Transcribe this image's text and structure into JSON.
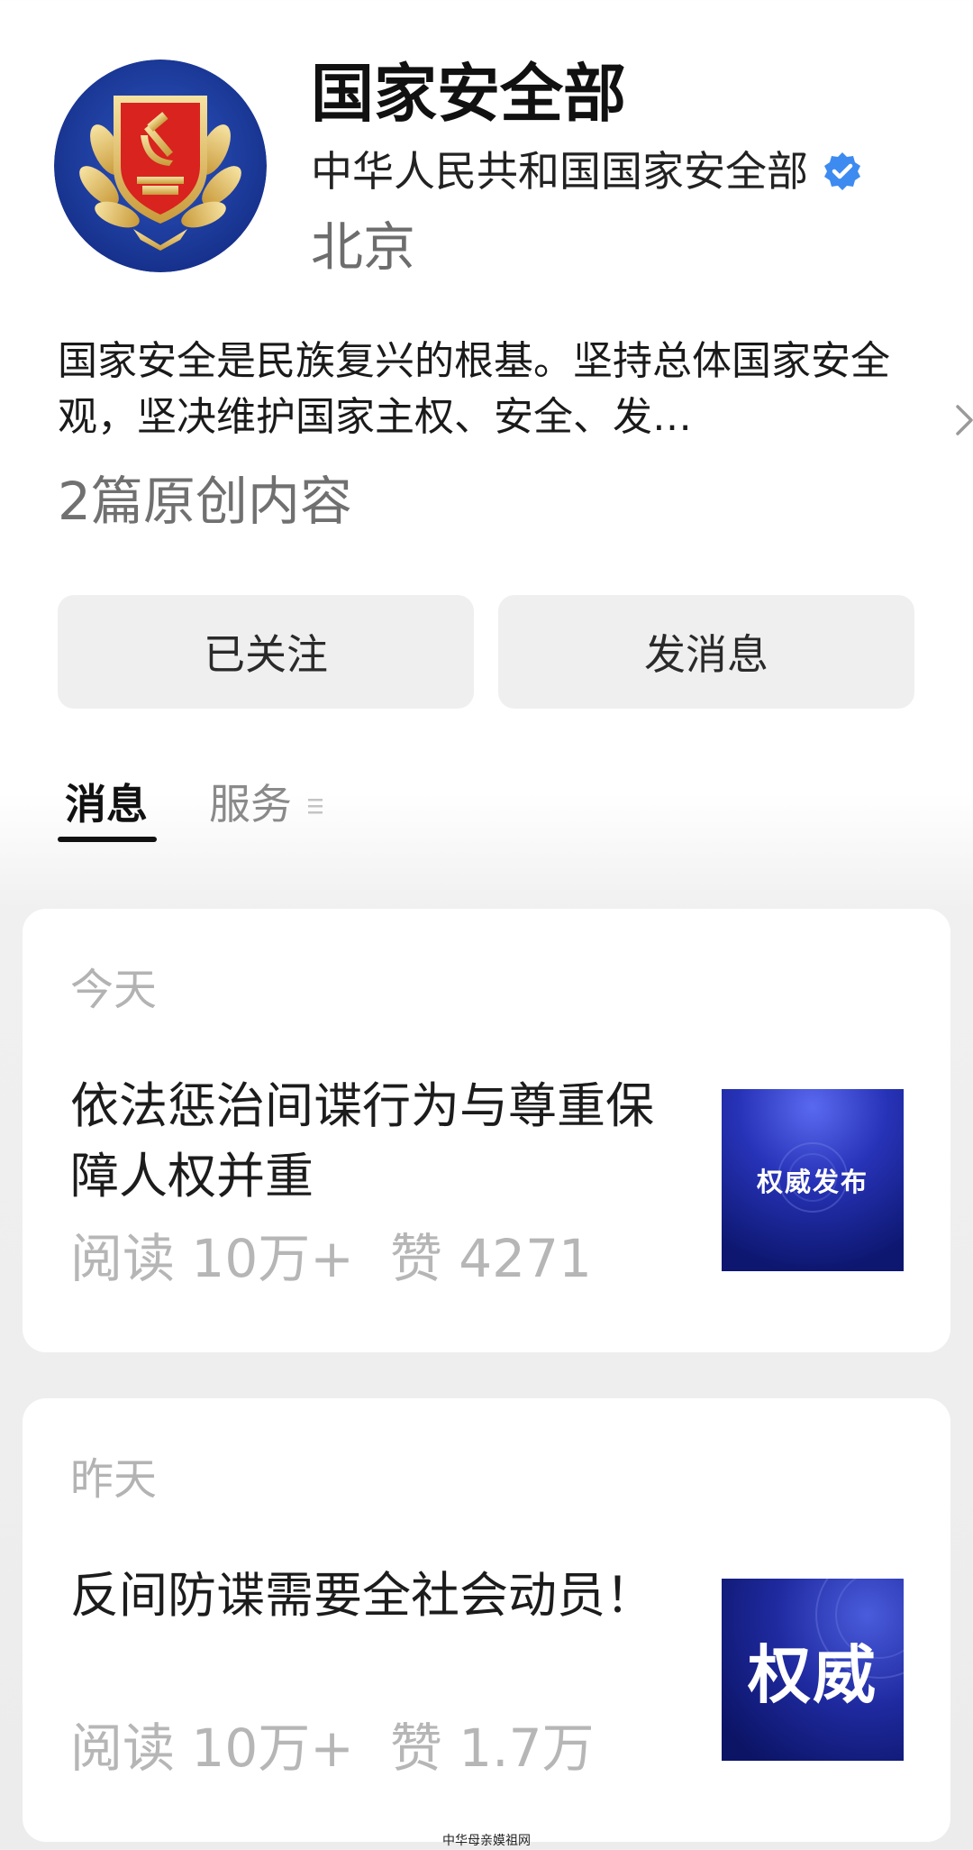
{
  "profile": {
    "name": "国家安全部",
    "verified_entity": "中华人民共和国国家安全部",
    "region": "北京",
    "bio": "国家安全是民族复兴的根基。坚持总体国家安全观，坚决维护国家主权、安全、发…",
    "original_count": "2篇原创内容"
  },
  "actions": {
    "follow_label": "已关注",
    "message_label": "发消息"
  },
  "tabs": {
    "messages": "消息",
    "services": "服务"
  },
  "feed": [
    {
      "day": "今天",
      "title": "依法惩治间谍行为与尊重保障人权并重",
      "reads": "阅读 10万+",
      "likes": "赞 4271",
      "thumb_text": "权威发布"
    },
    {
      "day": "昨天",
      "title": "反间防谍需要全社会动员！",
      "reads": "阅读 10万+",
      "likes": "赞 1.7万",
      "thumb_text": "权威"
    }
  ],
  "footer": {
    "watermark": "中华母亲嫫祖网"
  },
  "icons": {
    "avatar": "national-emblem-icon",
    "verified": "verified-check-icon",
    "bio_more": "chevron-right-icon",
    "tab_menu": "menu-icon"
  },
  "colors": {
    "verified_blue": "#3d8bf0",
    "thumb_blue": "#1d2a9e",
    "button_bg": "#efefef"
  }
}
